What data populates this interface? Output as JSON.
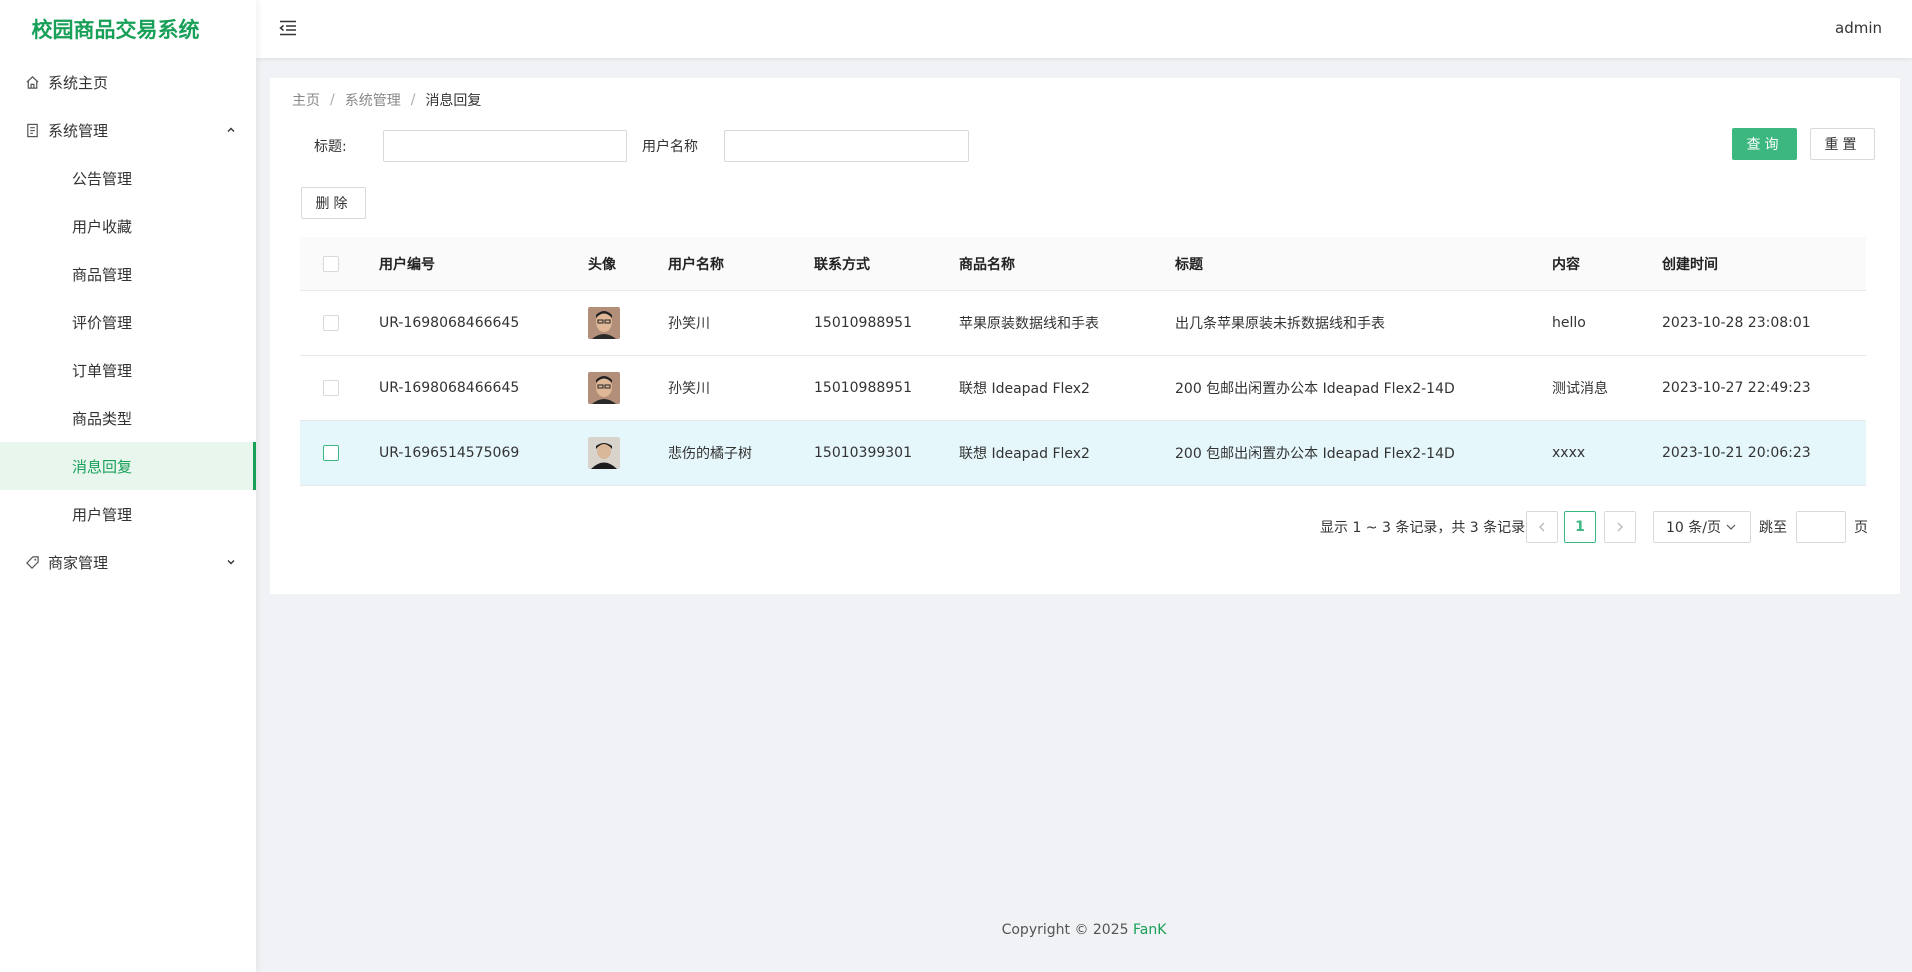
{
  "app": {
    "title": "校园商品交易系统",
    "user": "admin"
  },
  "sidebar": {
    "home": "系统主页",
    "system": {
      "label": "系统管理",
      "items": [
        "公告管理",
        "用户收藏",
        "商品管理",
        "评价管理",
        "订单管理",
        "商品类型",
        "消息回复",
        "用户管理"
      ],
      "active": "消息回复"
    },
    "merchant": "商家管理"
  },
  "breadcrumb": [
    "主页",
    "系统管理",
    "消息回复"
  ],
  "search": {
    "title_label": "标题:",
    "title_value": "",
    "username_label": "用户名称",
    "username_value": "",
    "query_button": "查询",
    "reset_button": "重置"
  },
  "actions": {
    "delete_button": "删除"
  },
  "table": {
    "columns": [
      "用户编号",
      "头像",
      "用户名称",
      "联系方式",
      "商品名称",
      "标题",
      "内容",
      "创建时间"
    ],
    "rows": [
      {
        "user_id": "UR-1698068466645",
        "username": "孙笑川",
        "phone": "15010988951",
        "product": "苹果原装数据线和手表",
        "title": "出几条苹果原装未拆数据线和手表",
        "content": "hello",
        "created": "2023-10-28 23:08:01"
      },
      {
        "user_id": "UR-1698068466645",
        "username": "孙笑川",
        "phone": "15010988951",
        "product": "联想 Ideapad Flex2",
        "title": "200 包邮出闲置办公本 Ideapad Flex2-14D",
        "content": "测试消息",
        "created": "2023-10-27 22:49:23"
      },
      {
        "user_id": "UR-1696514575069",
        "username": "悲伤的橘子树",
        "phone": "15010399301",
        "product": "联想 Ideapad Flex2",
        "title": "200 包邮出闲置办公本 Ideapad Flex2-14D",
        "content": "xxxx",
        "created": "2023-10-21 20:06:23"
      }
    ]
  },
  "pagination": {
    "summary": "显示 1 ~ 3 条记录，共 3 条记录",
    "current_page": "1",
    "page_size": "10 条/页",
    "jump_label": "跳至",
    "jump_value": "",
    "page_suffix": "页"
  },
  "footer": {
    "copyright": "Copyright © 2025 ",
    "brand": "FanK"
  },
  "colors": {
    "accent": "#18a058",
    "button_primary": "#3cb77f",
    "row_highlight": "#e6f7fb"
  }
}
